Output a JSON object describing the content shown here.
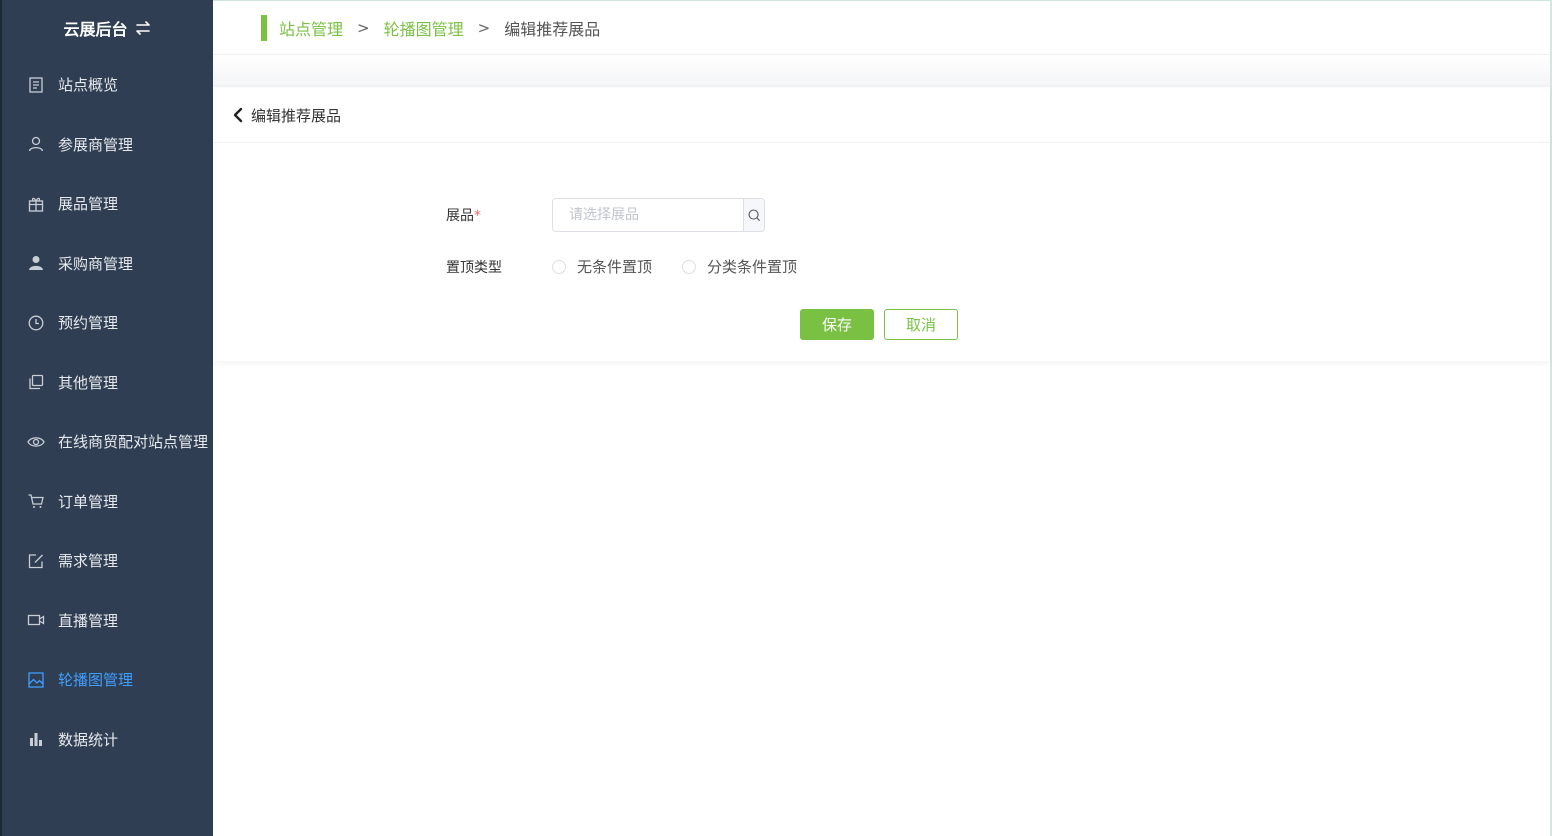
{
  "sidebar": {
    "title": "云展后台",
    "items": [
      {
        "label": "站点概览",
        "icon": "document-icon"
      },
      {
        "label": "参展商管理",
        "icon": "user-icon"
      },
      {
        "label": "展品管理",
        "icon": "gift-icon"
      },
      {
        "label": "采购商管理",
        "icon": "person-filled-icon"
      },
      {
        "label": "预约管理",
        "icon": "clock-icon"
      },
      {
        "label": "其他管理",
        "icon": "copy-icon"
      },
      {
        "label": "在线商贸配对站点管理",
        "icon": "eye-icon"
      },
      {
        "label": "订单管理",
        "icon": "cart-icon"
      },
      {
        "label": "需求管理",
        "icon": "edit-icon"
      },
      {
        "label": "直播管理",
        "icon": "video-icon"
      },
      {
        "label": "轮播图管理",
        "icon": "picture-icon",
        "active": true
      },
      {
        "label": "数据统计",
        "icon": "bar-chart-icon"
      }
    ],
    "colors": {
      "background": "#2f3e52",
      "active": "#409eff"
    }
  },
  "breadcrumb": {
    "items": [
      "站点管理",
      "轮播图管理",
      "编辑推荐展品"
    ],
    "separator": ">"
  },
  "card": {
    "title": "编辑推荐展品"
  },
  "form": {
    "exhibit": {
      "label": "展品",
      "required_mark": "*",
      "placeholder": "请选择展品",
      "value": ""
    },
    "top_type": {
      "label": "置顶类型",
      "options": [
        "无条件置顶",
        "分类条件置顶"
      ],
      "selected": null
    },
    "save_label": "保存",
    "cancel_label": "取消"
  },
  "theme": {
    "accent": "#7ac143",
    "required": "#f56c6c"
  }
}
